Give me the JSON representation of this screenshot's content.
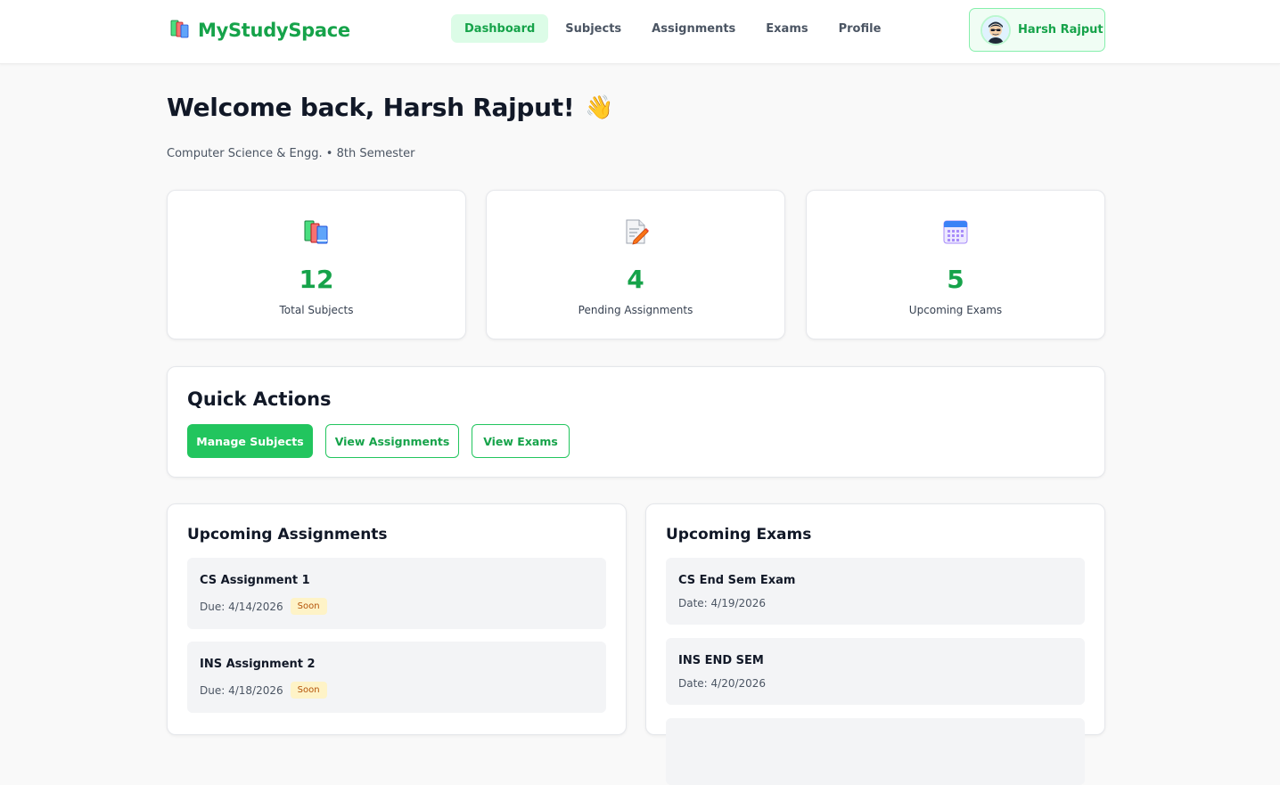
{
  "brand": {
    "name": "MyStudySpace",
    "icon": "books-icon"
  },
  "nav": {
    "items": [
      {
        "label": "Dashboard",
        "active": true
      },
      {
        "label": "Subjects",
        "active": false
      },
      {
        "label": "Assignments",
        "active": false
      },
      {
        "label": "Exams",
        "active": false
      },
      {
        "label": "Profile",
        "active": false
      }
    ]
  },
  "user": {
    "name": "Harsh Rajput",
    "avatar": "avatar-icon"
  },
  "welcome": {
    "title": "Welcome back, Harsh Rajput!",
    "emoji": "👋",
    "subtitle": "Computer Science & Engg. • 8th Semester"
  },
  "stats": [
    {
      "icon": "books-icon",
      "value": "12",
      "label": "Total Subjects"
    },
    {
      "icon": "memo-icon",
      "value": "4",
      "label": "Pending Assignments"
    },
    {
      "icon": "calendar-icon",
      "value": "5",
      "label": "Upcoming Exams"
    }
  ],
  "quick_actions": {
    "title": "Quick Actions",
    "buttons": [
      "Manage Subjects",
      "View Assignments",
      "View Exams"
    ]
  },
  "upcoming_assignments": {
    "title": "Upcoming Assignments",
    "items": [
      {
        "title": "CS Assignment 1",
        "due": "Due: 4/14/2026",
        "badge": "Soon"
      },
      {
        "title": "INS Assignment 2",
        "due": "Due: 4/18/2026",
        "badge": "Soon"
      }
    ]
  },
  "upcoming_exams": {
    "title": "Upcoming Exams",
    "items": [
      {
        "title": "CS End Sem Exam",
        "date": "Date: 4/19/2026"
      },
      {
        "title": "INS END SEM",
        "date": "Date: 4/20/2026"
      }
    ]
  },
  "colors": {
    "accent": "#16a34a",
    "accent_bright": "#22c55e",
    "accent_bg": "#dcfce7",
    "badge_bg": "#fef3c7",
    "badge_text": "#b45309"
  }
}
